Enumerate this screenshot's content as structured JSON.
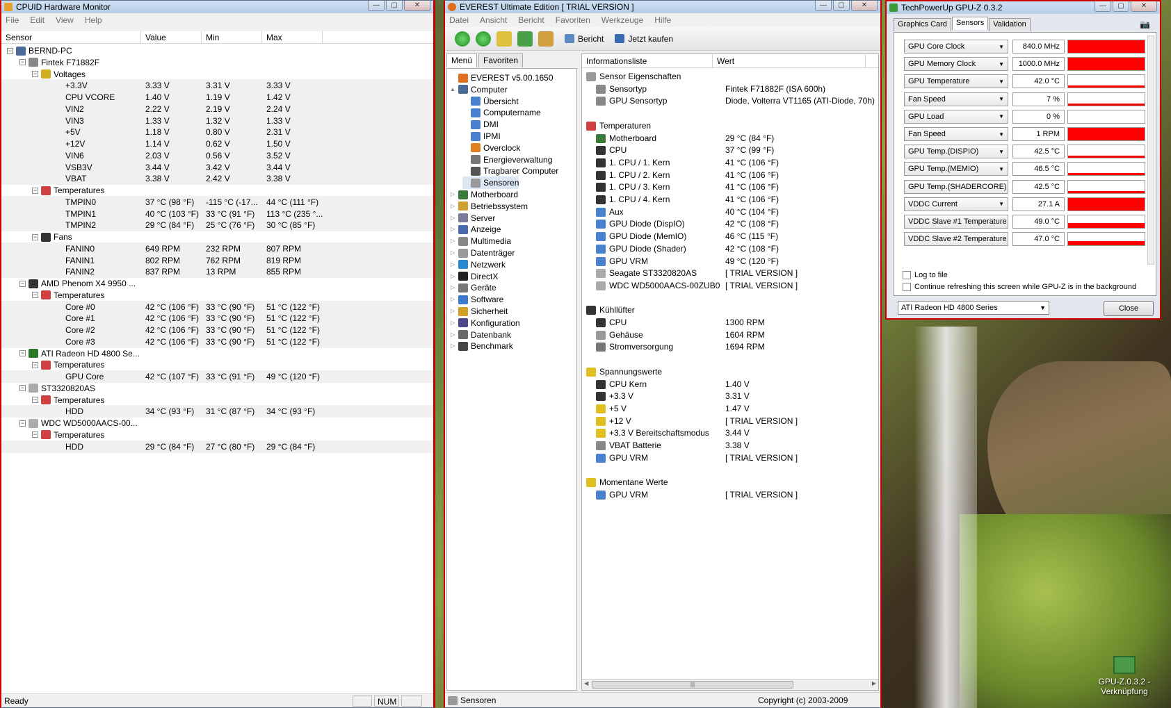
{
  "cpuid": {
    "title": "CPUID Hardware Monitor",
    "menu": [
      "File",
      "Edit",
      "View",
      "Help"
    ],
    "columns": [
      "Sensor",
      "Value",
      "Min",
      "Max"
    ],
    "rows": [
      {
        "d": 0,
        "t": "n",
        "l": "BERND-PC",
        "icon": "computer-icon"
      },
      {
        "d": 1,
        "t": "n",
        "l": "Fintek F71882F",
        "icon": "chip-icon"
      },
      {
        "d": 2,
        "t": "n",
        "l": "Voltages",
        "icon": "voltage-icon"
      },
      {
        "d": 3,
        "t": "l",
        "l": "+3.3V",
        "v": "3.33 V",
        "mn": "3.31 V",
        "mx": "3.33 V"
      },
      {
        "d": 3,
        "t": "l",
        "l": "CPU VCORE",
        "v": "1.40 V",
        "mn": "1.19 V",
        "mx": "1.42 V"
      },
      {
        "d": 3,
        "t": "l",
        "l": "VIN2",
        "v": "2.22 V",
        "mn": "2.19 V",
        "mx": "2.24 V"
      },
      {
        "d": 3,
        "t": "l",
        "l": "VIN3",
        "v": "1.33 V",
        "mn": "1.32 V",
        "mx": "1.33 V"
      },
      {
        "d": 3,
        "t": "l",
        "l": "+5V",
        "v": "1.18 V",
        "mn": "0.80 V",
        "mx": "2.31 V"
      },
      {
        "d": 3,
        "t": "l",
        "l": "+12V",
        "v": "1.14 V",
        "mn": "0.62 V",
        "mx": "1.50 V"
      },
      {
        "d": 3,
        "t": "l",
        "l": "VIN6",
        "v": "2.03 V",
        "mn": "0.56 V",
        "mx": "3.52 V"
      },
      {
        "d": 3,
        "t": "l",
        "l": "VSB3V",
        "v": "3.44 V",
        "mn": "3.42 V",
        "mx": "3.44 V"
      },
      {
        "d": 3,
        "t": "l",
        "l": "VBAT",
        "v": "3.38 V",
        "mn": "2.42 V",
        "mx": "3.38 V"
      },
      {
        "d": 2,
        "t": "n",
        "l": "Temperatures",
        "icon": "thermometer-icon"
      },
      {
        "d": 3,
        "t": "l",
        "l": "TMPIN0",
        "v": "37 °C  (98 °F)",
        "mn": "-115 °C  (-17...",
        "mx": "44 °C  (111 °F)"
      },
      {
        "d": 3,
        "t": "l",
        "l": "TMPIN1",
        "v": "40 °C  (103 °F)",
        "mn": "33 °C  (91 °F)",
        "mx": "113 °C  (235 °..."
      },
      {
        "d": 3,
        "t": "l",
        "l": "TMPIN2",
        "v": "29 °C  (84 °F)",
        "mn": "25 °C  (76 °F)",
        "mx": "30 °C  (85 °F)"
      },
      {
        "d": 2,
        "t": "n",
        "l": "Fans",
        "icon": "fan-icon"
      },
      {
        "d": 3,
        "t": "l",
        "l": "FANIN0",
        "v": "649 RPM",
        "mn": "232 RPM",
        "mx": "807 RPM"
      },
      {
        "d": 3,
        "t": "l",
        "l": "FANIN1",
        "v": "802 RPM",
        "mn": "762 RPM",
        "mx": "819 RPM"
      },
      {
        "d": 3,
        "t": "l",
        "l": "FANIN2",
        "v": "837 RPM",
        "mn": "13 RPM",
        "mx": "855 RPM"
      },
      {
        "d": 1,
        "t": "n",
        "l": "AMD Phenom X4 9950 ...",
        "icon": "cpu-icon"
      },
      {
        "d": 2,
        "t": "n",
        "l": "Temperatures",
        "icon": "thermometer-icon"
      },
      {
        "d": 3,
        "t": "l",
        "l": "Core #0",
        "v": "42 °C  (106 °F)",
        "mn": "33 °C  (90 °F)",
        "mx": "51 °C  (122 °F)"
      },
      {
        "d": 3,
        "t": "l",
        "l": "Core #1",
        "v": "42 °C  (106 °F)",
        "mn": "33 °C  (90 °F)",
        "mx": "51 °C  (122 °F)"
      },
      {
        "d": 3,
        "t": "l",
        "l": "Core #2",
        "v": "42 °C  (106 °F)",
        "mn": "33 °C  (90 °F)",
        "mx": "51 °C  (122 °F)"
      },
      {
        "d": 3,
        "t": "l",
        "l": "Core #3",
        "v": "42 °C  (106 °F)",
        "mn": "33 °C  (90 °F)",
        "mx": "51 °C  (122 °F)"
      },
      {
        "d": 1,
        "t": "n",
        "l": "ATI Radeon HD 4800 Se...",
        "icon": "gpu-icon"
      },
      {
        "d": 2,
        "t": "n",
        "l": "Temperatures",
        "icon": "thermometer-icon"
      },
      {
        "d": 3,
        "t": "l",
        "l": "GPU Core",
        "v": "42 °C  (107 °F)",
        "mn": "33 °C  (91 °F)",
        "mx": "49 °C  (120 °F)"
      },
      {
        "d": 1,
        "t": "n",
        "l": "ST3320820AS",
        "icon": "hdd-icon"
      },
      {
        "d": 2,
        "t": "n",
        "l": "Temperatures",
        "icon": "thermometer-icon"
      },
      {
        "d": 3,
        "t": "l",
        "l": "HDD",
        "v": "34 °C  (93 °F)",
        "mn": "31 °C  (87 °F)",
        "mx": "34 °C  (93 °F)"
      },
      {
        "d": 1,
        "t": "n",
        "l": "WDC WD5000AACS-00...",
        "icon": "hdd-icon"
      },
      {
        "d": 2,
        "t": "n",
        "l": "Temperatures",
        "icon": "thermometer-icon"
      },
      {
        "d": 3,
        "t": "l",
        "l": "HDD",
        "v": "29 °C  (84 °F)",
        "mn": "27 °C  (80 °F)",
        "mx": "29 °C  (84 °F)"
      }
    ],
    "status": "Ready",
    "status_num": "NUM"
  },
  "everest": {
    "title": "EVEREST Ultimate Edition  [ TRIAL VERSION ]",
    "menu": [
      "Datei",
      "Ansicht",
      "Bericht",
      "Favoriten",
      "Werkzeuge",
      "Hilfe"
    ],
    "toolbar": {
      "report": "Bericht",
      "buy": "Jetzt kaufen"
    },
    "tabs": [
      "Menü",
      "Favoriten"
    ],
    "tree": [
      {
        "d": 0,
        "l": "EVEREST v5.00.1650",
        "icon": "everest-icon",
        "exp": ""
      },
      {
        "d": 0,
        "l": "Computer",
        "icon": "computer-icon",
        "exp": "▲"
      },
      {
        "d": 1,
        "l": "Übersicht",
        "icon": "info-icon",
        "exp": ""
      },
      {
        "d": 1,
        "l": "Computername",
        "icon": "info-icon",
        "exp": ""
      },
      {
        "d": 1,
        "l": "DMI",
        "icon": "info-icon",
        "exp": ""
      },
      {
        "d": 1,
        "l": "IPMI",
        "icon": "info-icon",
        "exp": ""
      },
      {
        "d": 1,
        "l": "Overclock",
        "icon": "flame-icon",
        "exp": ""
      },
      {
        "d": 1,
        "l": "Energieverwaltung",
        "icon": "power-icon",
        "exp": ""
      },
      {
        "d": 1,
        "l": "Tragbarer Computer",
        "icon": "laptop-icon",
        "exp": ""
      },
      {
        "d": 1,
        "l": "Sensoren",
        "icon": "sensor-icon",
        "exp": "",
        "sel": true
      },
      {
        "d": 0,
        "l": "Motherboard",
        "icon": "motherboard-icon",
        "exp": "▷"
      },
      {
        "d": 0,
        "l": "Betriebssystem",
        "icon": "windows-icon",
        "exp": "▷"
      },
      {
        "d": 0,
        "l": "Server",
        "icon": "server-icon",
        "exp": "▷"
      },
      {
        "d": 0,
        "l": "Anzeige",
        "icon": "display-icon",
        "exp": "▷"
      },
      {
        "d": 0,
        "l": "Multimedia",
        "icon": "multimedia-icon",
        "exp": "▷"
      },
      {
        "d": 0,
        "l": "Datenträger",
        "icon": "disk-icon",
        "exp": "▷"
      },
      {
        "d": 0,
        "l": "Netzwerk",
        "icon": "network-icon",
        "exp": "▷"
      },
      {
        "d": 0,
        "l": "DirectX",
        "icon": "directx-icon",
        "exp": "▷"
      },
      {
        "d": 0,
        "l": "Geräte",
        "icon": "devices-icon",
        "exp": "▷"
      },
      {
        "d": 0,
        "l": "Software",
        "icon": "software-icon",
        "exp": "▷"
      },
      {
        "d": 0,
        "l": "Sicherheit",
        "icon": "shield-icon",
        "exp": "▷"
      },
      {
        "d": 0,
        "l": "Konfiguration",
        "icon": "config-icon",
        "exp": "▷"
      },
      {
        "d": 0,
        "l": "Datenbank",
        "icon": "database-icon",
        "exp": "▷"
      },
      {
        "d": 0,
        "l": "Benchmark",
        "icon": "benchmark-icon",
        "exp": "▷"
      }
    ],
    "columns": [
      "Informationsliste",
      "Wert"
    ],
    "rows": [
      {
        "g": 1,
        "l": "Sensor Eigenschaften",
        "icon": "sensor-icon",
        "top": 0
      },
      {
        "g": 0,
        "l": "Sensortyp",
        "v": "Fintek F71882F  (ISA 600h)",
        "icon": "chip-icon"
      },
      {
        "g": 0,
        "l": "GPU Sensortyp",
        "v": "Diode, Volterra VT1165  (ATI-Diode, 70h)",
        "icon": "chip-icon"
      },
      {
        "g": 2
      },
      {
        "g": 1,
        "l": "Temperaturen",
        "icon": "thermometer-icon"
      },
      {
        "g": 0,
        "l": "Motherboard",
        "v": "29 °C  (84 °F)",
        "icon": "motherboard-icon"
      },
      {
        "g": 0,
        "l": "CPU",
        "v": "37 °C  (99 °F)",
        "icon": "cpu-icon"
      },
      {
        "g": 0,
        "l": "1. CPU / 1. Kern",
        "v": "41 °C  (106 °F)",
        "icon": "cpu-icon"
      },
      {
        "g": 0,
        "l": "1. CPU / 2. Kern",
        "v": "41 °C  (106 °F)",
        "icon": "cpu-icon"
      },
      {
        "g": 0,
        "l": "1. CPU / 3. Kern",
        "v": "41 °C  (106 °F)",
        "icon": "cpu-icon"
      },
      {
        "g": 0,
        "l": "1. CPU / 4. Kern",
        "v": "41 °C  (106 °F)",
        "icon": "cpu-icon"
      },
      {
        "g": 0,
        "l": "Aux",
        "v": "40 °C  (104 °F)",
        "icon": "info-icon"
      },
      {
        "g": 0,
        "l": "GPU Diode (DispIO)",
        "v": "42 °C  (108 °F)",
        "icon": "info-icon"
      },
      {
        "g": 0,
        "l": "GPU Diode (MemIO)",
        "v": "46 °C  (115 °F)",
        "icon": "info-icon"
      },
      {
        "g": 0,
        "l": "GPU Diode (Shader)",
        "v": "42 °C  (108 °F)",
        "icon": "info-icon"
      },
      {
        "g": 0,
        "l": "GPU VRM",
        "v": "49 °C  (120 °F)",
        "icon": "info-icon"
      },
      {
        "g": 0,
        "l": "Seagate ST3320820AS",
        "v": "[ TRIAL VERSION ]",
        "icon": "hdd-icon"
      },
      {
        "g": 0,
        "l": "WDC WD5000AACS-00ZUB0",
        "v": "[ TRIAL VERSION ]",
        "icon": "hdd-icon"
      },
      {
        "g": 2
      },
      {
        "g": 1,
        "l": "Kühllüfter",
        "icon": "fan-icon"
      },
      {
        "g": 0,
        "l": "CPU",
        "v": "1300 RPM",
        "icon": "cpu-icon"
      },
      {
        "g": 0,
        "l": "Gehäuse",
        "v": "1604 RPM",
        "icon": "case-icon"
      },
      {
        "g": 0,
        "l": "Stromversorgung",
        "v": "1694 RPM",
        "icon": "power-icon"
      },
      {
        "g": 2
      },
      {
        "g": 1,
        "l": "Spannungswerte",
        "icon": "warning-icon"
      },
      {
        "g": 0,
        "l": "CPU Kern",
        "v": "1.40 V",
        "icon": "cpu-icon"
      },
      {
        "g": 0,
        "l": "+3.3 V",
        "v": "3.31 V",
        "icon": "cpu-icon"
      },
      {
        "g": 0,
        "l": "+5 V",
        "v": "1.47 V",
        "icon": "warning-icon"
      },
      {
        "g": 0,
        "l": "+12 V",
        "v": "[ TRIAL VERSION ]",
        "icon": "warning-icon"
      },
      {
        "g": 0,
        "l": "+3.3 V Bereitschaftsmodus",
        "v": "3.44 V",
        "icon": "warning-icon"
      },
      {
        "g": 0,
        "l": "VBAT Batterie",
        "v": "3.38 V",
        "icon": "battery-icon"
      },
      {
        "g": 0,
        "l": "GPU VRM",
        "v": "[ TRIAL VERSION ]",
        "icon": "info-icon"
      },
      {
        "g": 2
      },
      {
        "g": 1,
        "l": "Momentane Werte",
        "icon": "warning-icon"
      },
      {
        "g": 0,
        "l": "GPU VRM",
        "v": "[ TRIAL VERSION ]",
        "icon": "info-icon"
      }
    ],
    "status_left": "Sensoren",
    "status_right": "Copyright (c) 2003-2009"
  },
  "gpuz": {
    "title": "TechPowerUp GPU-Z 0.3.2",
    "tabs": [
      "Graphics Card",
      "Sensors",
      "Validation"
    ],
    "sensors": [
      {
        "name": "GPU Core Clock",
        "value": "840.0 MHz",
        "level": 1.0
      },
      {
        "name": "GPU Memory Clock",
        "value": "1000.0 MHz",
        "level": 1.0
      },
      {
        "name": "GPU Temperature",
        "value": "42.0 °C",
        "level": 0.15
      },
      {
        "name": "Fan Speed",
        "value": "7 %",
        "level": 0.04
      },
      {
        "name": "GPU Load",
        "value": "0 %",
        "level": 0.0
      },
      {
        "name": "Fan Speed",
        "value": "1 RPM",
        "level": 1.0
      },
      {
        "name": "GPU Temp.(DISPIO)",
        "value": "42.5 °C",
        "level": 0.15
      },
      {
        "name": "GPU Temp.(MEMIO)",
        "value": "46.5 °C",
        "level": 0.18
      },
      {
        "name": "GPU Temp.(SHADERCORE)",
        "value": "42.5 °C",
        "level": 0.12
      },
      {
        "name": "VDDC Current",
        "value": "27.1 A",
        "level": 1.0
      },
      {
        "name": "VDDC Slave #1 Temperature",
        "value": "49.0 °C",
        "level": 0.35
      },
      {
        "name": "VDDC Slave #2 Temperature",
        "value": "47.0 °C",
        "level": 0.3
      }
    ],
    "log_label": "Log to file",
    "refresh_label": "Continue refreshing this screen while GPU-Z is in the background",
    "card_select": "ATI Radeon HD 4800 Series",
    "close": "Close"
  },
  "desktop": {
    "icon_label_1": "GPU-Z.0.3.2 -",
    "icon_label_2": "Verknüpfung"
  },
  "colors": {
    "accent_red": "#ff0000",
    "window_border": "#cc0000"
  }
}
